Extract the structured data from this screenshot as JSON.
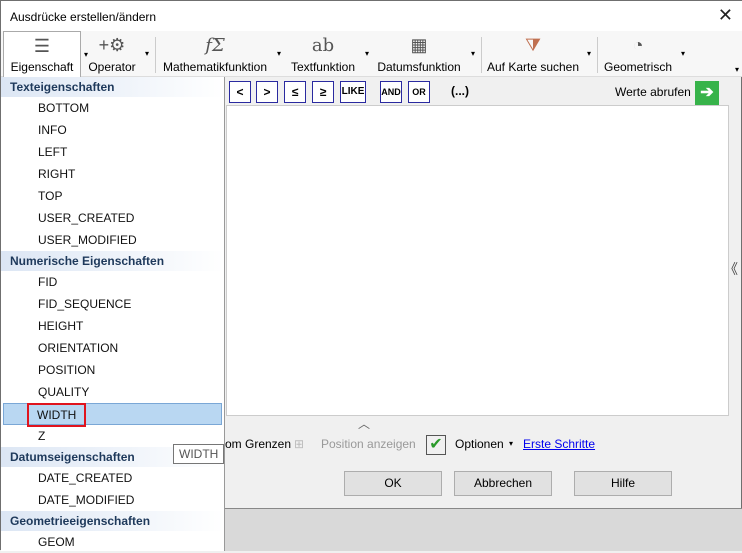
{
  "window": {
    "title": "Ausdrücke erstellen/ändern",
    "close": "✕"
  },
  "ribbon": [
    {
      "label": "Eigenschaft",
      "icon": "☰"
    },
    {
      "label": "Operator",
      "icon": "+⚙"
    },
    {
      "label": "Mathematikfunktion",
      "icon": "fΣ"
    },
    {
      "label": "Textfunktion",
      "icon": "ab"
    },
    {
      "label": "Datumsfunktion",
      "icon": "▦"
    },
    {
      "label": "Auf Karte suchen",
      "icon": "⧩"
    },
    {
      "label": "Geometrisch",
      "icon": "◔"
    }
  ],
  "menu": {
    "sections": [
      {
        "header": "Texteigenschaften",
        "items": [
          "BOTTOM",
          "INFO",
          "LEFT",
          "RIGHT",
          "TOP",
          "USER_CREATED",
          "USER_MODIFIED"
        ]
      },
      {
        "header": "Numerische Eigenschaften",
        "items": [
          "FID",
          "FID_SEQUENCE",
          "HEIGHT",
          "ORIENTATION",
          "POSITION",
          "QUALITY",
          "WIDTH",
          "Z"
        ]
      },
      {
        "header": "Datumseigenschaften",
        "items": [
          "DATE_CREATED",
          "DATE_MODIFIED"
        ]
      },
      {
        "header": "Geometrieeigenschaften",
        "items": [
          "GEOM"
        ]
      }
    ],
    "selected": "WIDTH",
    "tooltip": "WIDTH"
  },
  "operators": [
    "<",
    ">",
    "≤",
    "≥",
    "LIKE",
    "AND",
    "OR",
    "(...)"
  ],
  "werte_abrufen": "Werte abrufen",
  "bottom": {
    "grenzen": "om Grenzen",
    "position": "Position anzeigen",
    "optionen": "Optionen",
    "erste_schritte": "Erste Schritte"
  },
  "buttons": {
    "ok": "OK",
    "cancel": "Abbrechen",
    "help": "Hilfe"
  }
}
